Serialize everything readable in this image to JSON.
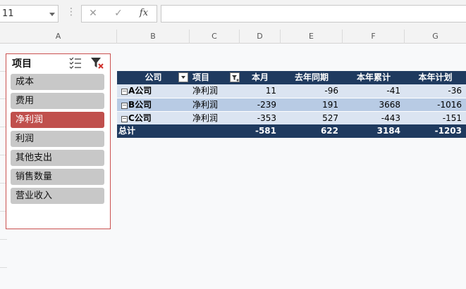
{
  "namebox": {
    "value": "11"
  },
  "formula_bar": {
    "cancel_glyph": "✕",
    "enter_glyph": "✓",
    "fx_label": "fx",
    "value": ""
  },
  "columns": [
    "A",
    "B",
    "C",
    "D",
    "E",
    "F",
    "G"
  ],
  "slicer": {
    "title": "项目",
    "items": [
      {
        "label": "成本",
        "selected": false
      },
      {
        "label": "费用",
        "selected": false
      },
      {
        "label": "净利润",
        "selected": true
      },
      {
        "label": "利润",
        "selected": false
      },
      {
        "label": "其他支出",
        "selected": false
      },
      {
        "label": "销售数量",
        "selected": false
      },
      {
        "label": "营业收入",
        "selected": false
      }
    ]
  },
  "pivot": {
    "headers": [
      "公司",
      "项目",
      "本月",
      "去年同期",
      "本年累计",
      "本年计划"
    ],
    "rows": [
      {
        "company": "A公司",
        "item": "净利润",
        "values": [
          "11",
          "-96",
          "-41",
          "-36"
        ]
      },
      {
        "company": "B公司",
        "item": "净利润",
        "values": [
          "-239",
          "191",
          "3668",
          "-1016"
        ]
      },
      {
        "company": "C公司",
        "item": "净利润",
        "values": [
          "-353",
          "527",
          "-443",
          "-151"
        ]
      }
    ],
    "total": {
      "label": "总计",
      "values": [
        "-581",
        "622",
        "3184",
        "-1203"
      ]
    }
  },
  "colors": {
    "header_bg": "#1f3a5f",
    "row_light": "#dbe4f1",
    "row_mid": "#b8cbe4",
    "slicer_selected": "#c0504d",
    "slicer_item": "#c8c8c8"
  }
}
